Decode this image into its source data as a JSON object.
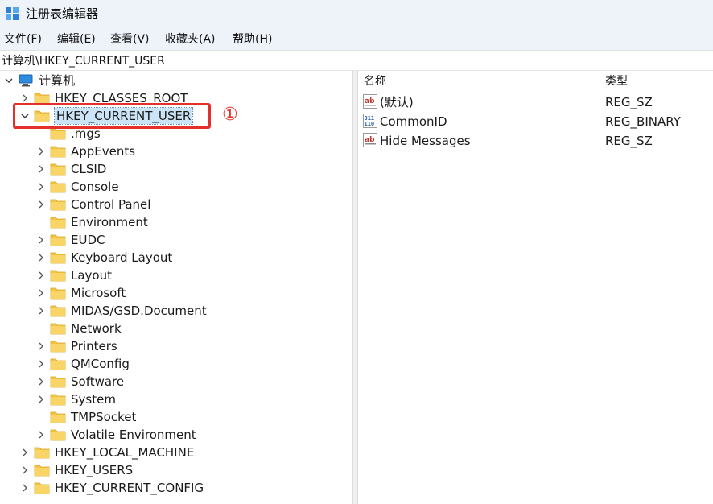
{
  "window": {
    "title": "注册表编辑器"
  },
  "menu": {
    "items": [
      "文件(F)",
      "编辑(E)",
      "查看(V)",
      "收藏夹(A)",
      "帮助(H)"
    ]
  },
  "address": {
    "path": "计算机\\HKEY_CURRENT_USER"
  },
  "tree": {
    "root": "计算机",
    "hives": {
      "classes_root": "HKEY_CLASSES_ROOT",
      "current_user": "HKEY_CURRENT_USER",
      "local_machine": "HKEY_LOCAL_MACHINE",
      "users": "HKEY_USERS",
      "current_config": "HKEY_CURRENT_CONFIG"
    },
    "current_user_children": [
      ".mgs",
      "AppEvents",
      "CLSID",
      "Console",
      "Control Panel",
      "Environment",
      "EUDC",
      "Keyboard Layout",
      "Layout",
      "Microsoft",
      "MIDAS/GSD.Document",
      "Network",
      "Printers",
      "QMConfig",
      "Software",
      "System",
      "TMPSocket",
      "Volatile Environment"
    ],
    "selected": "HKEY_CURRENT_USER"
  },
  "annotation": {
    "marker": "①",
    "color": "#e4302a"
  },
  "values": {
    "columns": {
      "name": "名称",
      "type": "类型"
    },
    "rows": [
      {
        "name": "(默认)",
        "type": "REG_SZ",
        "icon": "string-value-icon"
      },
      {
        "name": "CommonID",
        "type": "REG_BINARY",
        "icon": "binary-value-icon"
      },
      {
        "name": "Hide Messages",
        "type": "REG_SZ",
        "icon": "string-value-icon"
      }
    ]
  },
  "colors": {
    "selection": "#cce4f7",
    "chrome": "#eef3fa",
    "folder": "#f4c542"
  }
}
